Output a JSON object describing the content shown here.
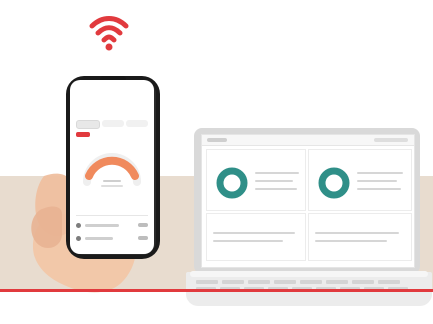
{
  "colors": {
    "accent": "#e13a3e",
    "band": "#e8dccf",
    "teal": "#2f8f88",
    "gauge_warm": "#f08a5d"
  },
  "icons": {
    "wifi": "wifi-icon"
  },
  "phone_app": {
    "title": "",
    "tabs": [
      "",
      "",
      ""
    ],
    "badge": "",
    "gauge": {
      "value": "",
      "label": ""
    },
    "rows": [
      {
        "label": ""
      },
      {
        "label": ""
      }
    ]
  },
  "laptop_app": {
    "topbar": {
      "title": ""
    },
    "panels": [
      {
        "title": ""
      },
      {
        "title": ""
      },
      {
        "title": ""
      },
      {
        "title": ""
      }
    ]
  }
}
